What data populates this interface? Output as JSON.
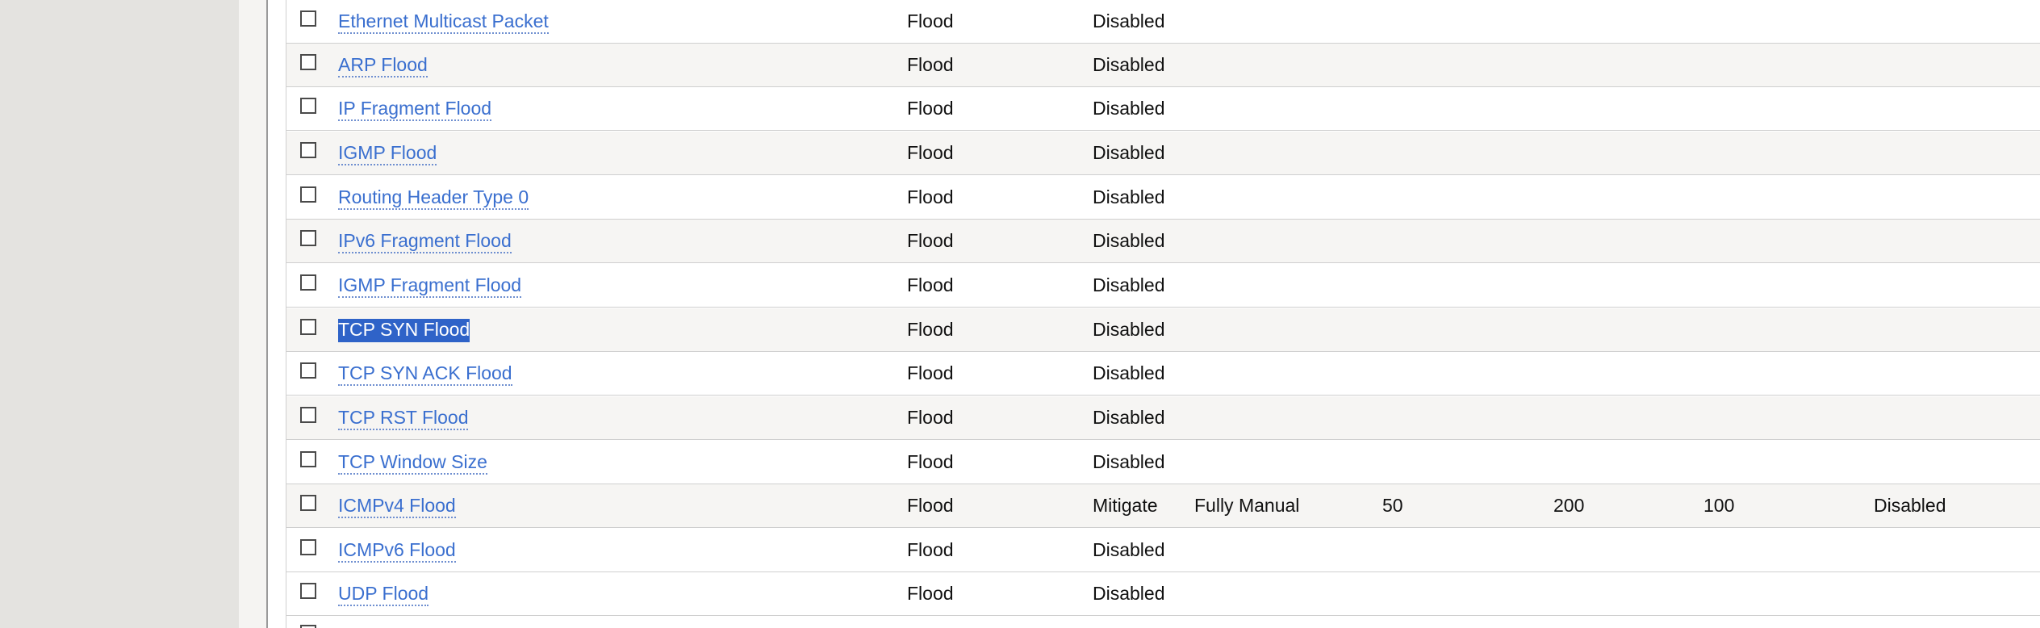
{
  "table": {
    "rows": [
      {
        "name": "Ethernet Multicast Packet",
        "type": "Flood",
        "action": "Disabled",
        "mode": "",
        "v1": "",
        "v2": "",
        "v3": "",
        "v4": "",
        "selected": false
      },
      {
        "name": "ARP Flood",
        "type": "Flood",
        "action": "Disabled",
        "mode": "",
        "v1": "",
        "v2": "",
        "v3": "",
        "v4": "",
        "selected": false
      },
      {
        "name": "IP Fragment Flood",
        "type": "Flood",
        "action": "Disabled",
        "mode": "",
        "v1": "",
        "v2": "",
        "v3": "",
        "v4": "",
        "selected": false
      },
      {
        "name": "IGMP Flood",
        "type": "Flood",
        "action": "Disabled",
        "mode": "",
        "v1": "",
        "v2": "",
        "v3": "",
        "v4": "",
        "selected": false
      },
      {
        "name": "Routing Header Type 0",
        "type": "Flood",
        "action": "Disabled",
        "mode": "",
        "v1": "",
        "v2": "",
        "v3": "",
        "v4": "",
        "selected": false
      },
      {
        "name": "IPv6 Fragment Flood",
        "type": "Flood",
        "action": "Disabled",
        "mode": "",
        "v1": "",
        "v2": "",
        "v3": "",
        "v4": "",
        "selected": false
      },
      {
        "name": "IGMP Fragment Flood",
        "type": "Flood",
        "action": "Disabled",
        "mode": "",
        "v1": "",
        "v2": "",
        "v3": "",
        "v4": "",
        "selected": false
      },
      {
        "name": "TCP SYN Flood",
        "type": "Flood",
        "action": "Disabled",
        "mode": "",
        "v1": "",
        "v2": "",
        "v3": "",
        "v4": "",
        "selected": true
      },
      {
        "name": "TCP SYN ACK Flood",
        "type": "Flood",
        "action": "Disabled",
        "mode": "",
        "v1": "",
        "v2": "",
        "v3": "",
        "v4": "",
        "selected": false
      },
      {
        "name": "TCP RST Flood",
        "type": "Flood",
        "action": "Disabled",
        "mode": "",
        "v1": "",
        "v2": "",
        "v3": "",
        "v4": "",
        "selected": false
      },
      {
        "name": "TCP Window Size",
        "type": "Flood",
        "action": "Disabled",
        "mode": "",
        "v1": "",
        "v2": "",
        "v3": "",
        "v4": "",
        "selected": false
      },
      {
        "name": "ICMPv4 Flood",
        "type": "Flood",
        "action": "Mitigate",
        "mode": "Fully Manual",
        "v1": "50",
        "v2": "200",
        "v3": "100",
        "v4": "Disabled",
        "selected": false
      },
      {
        "name": "ICMPv6 Flood",
        "type": "Flood",
        "action": "Disabled",
        "mode": "",
        "v1": "",
        "v2": "",
        "v3": "",
        "v4": "",
        "selected": false
      },
      {
        "name": "UDP Flood",
        "type": "Flood",
        "action": "Disabled",
        "mode": "",
        "v1": "",
        "v2": "",
        "v3": "",
        "v4": "",
        "selected": false
      }
    ]
  }
}
